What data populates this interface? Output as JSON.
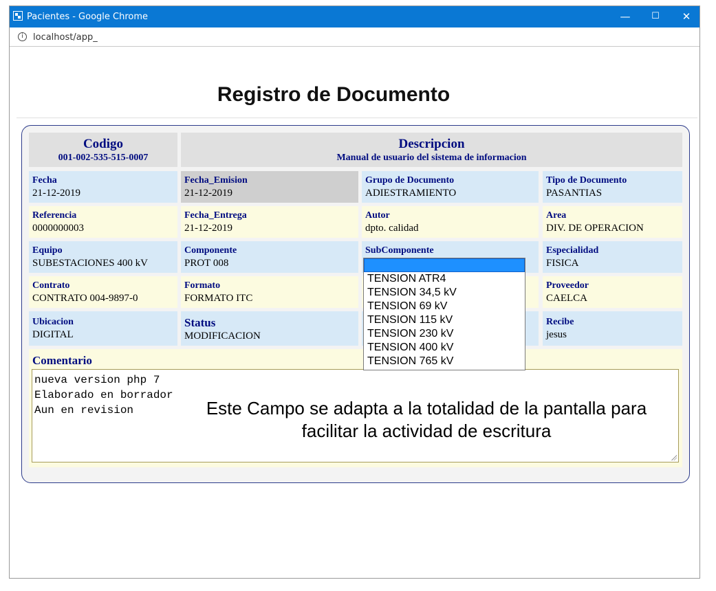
{
  "window": {
    "title": "Pacientes - Google Chrome",
    "url": "localhost/app_",
    "minimize": "—",
    "maximize": "☐",
    "close": "✕",
    "info_glyph": "i"
  },
  "page": {
    "title": "Registro de Documento"
  },
  "header": {
    "codigo": {
      "label": "Codigo",
      "value": "001-002-535-515-0007"
    },
    "descripcion": {
      "label": "Descripcion",
      "value": "Manual de usuario del sistema de informacion"
    }
  },
  "fields": {
    "fecha": {
      "label": "Fecha",
      "value": "21-12-2019"
    },
    "fecha_emision": {
      "label": "Fecha_Emision",
      "value": "21-12-2019"
    },
    "grupo_documento": {
      "label": "Grupo de Documento",
      "value": "ADIESTRAMIENTO"
    },
    "tipo_documento": {
      "label": "Tipo de Documento",
      "value": "PASANTIAS"
    },
    "referencia": {
      "label": "Referencia",
      "value": "0000000003"
    },
    "fecha_entrega": {
      "label": "Fecha_Entrega",
      "value": "21-12-2019"
    },
    "autor": {
      "label": "Autor",
      "value": "dpto. calidad"
    },
    "area": {
      "label": "Area",
      "value": "DIV. DE OPERACION"
    },
    "equipo": {
      "label": "Equipo",
      "value": "SUBESTACIONES 400 kV"
    },
    "componente": {
      "label": "Componente",
      "value": "PROT 008"
    },
    "subcomponente": {
      "label": "SubComponente"
    },
    "especialidad": {
      "label": "Especialidad",
      "value": "FISICA"
    },
    "contrato": {
      "label": "Contrato",
      "value": "CONTRATO 004-9897-0"
    },
    "formato": {
      "label": "Formato",
      "value": "FORMATO ITC"
    },
    "proveedor": {
      "label": "Proveedor",
      "value": "CAELCA"
    },
    "ubicacion": {
      "label": "Ubicacion",
      "value": "DIGITAL"
    },
    "status": {
      "label": "Status",
      "value": "MODIFICACION"
    },
    "recibe": {
      "label": "Recibe",
      "value": "jesus"
    }
  },
  "subcomponente_options": [
    "TENSION ATR4",
    "TENSION 34,5 kV",
    "TENSION 69 kV",
    "TENSION 115 kV",
    "TENSION 230 kV",
    "TENSION 400 kV",
    "TENSION 765 kV"
  ],
  "comentario": {
    "label": "Comentario",
    "text": "nueva version php 7\nElaborado en borrador\nAun en revision"
  },
  "annotation": {
    "line1": "Este Campo se adapta a la totalidad de la pantalla para",
    "line2": "facilitar la actividad de escritura"
  }
}
